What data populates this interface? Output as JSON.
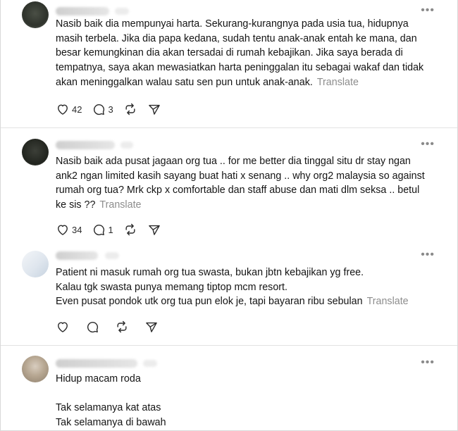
{
  "common": {
    "translate_label": "Translate",
    "more_label": "•••"
  },
  "posts": [
    {
      "lines": [
        "Nasib baik dia mempunyai harta. Sekurang-kurangnya pada usia tua, hidupnya",
        "masih terbela. Jika dia papa kedana, sudah tentu anak-anak entah ke mana, dan",
        "besar kemungkinan dia akan tersadai di rumah kebajikan. Jika saya berada di",
        "tempatnya, saya akan mewasiatkan harta peninggalan itu sebagai wakaf dan tidak",
        "akan meninggalkan walau satu sen pun untuk anak-anak."
      ],
      "likes": "42",
      "replies": "3"
    },
    {
      "lines": [
        "Nasib baik ada pusat jagaan org tua .. for me better dia tinggal situ dr stay ngan",
        "ank2 ngan limited kasih sayang buat hati x senang .. why org2 malaysia so against",
        "rumah org tua? Mrk ckp x comfortable dan staff abuse dan mati dlm seksa .. betul",
        "ke sis ??"
      ],
      "likes": "34",
      "replies": "1"
    },
    {
      "lines": [
        "Patient ni masuk rumah org tua swasta, bukan jbtn kebajikan yg free.",
        "Kalau tgk swasta punya memang tiptop mcm resort.",
        "Even pusat pondok utk org tua pun elok je, tapi bayaran ribu sebulan"
      ],
      "likes": "",
      "replies": ""
    },
    {
      "lines": [
        "Hidup macam roda",
        "",
        "Tak selamanya kat atas",
        "Tak selamanya di bawah"
      ]
    }
  ]
}
